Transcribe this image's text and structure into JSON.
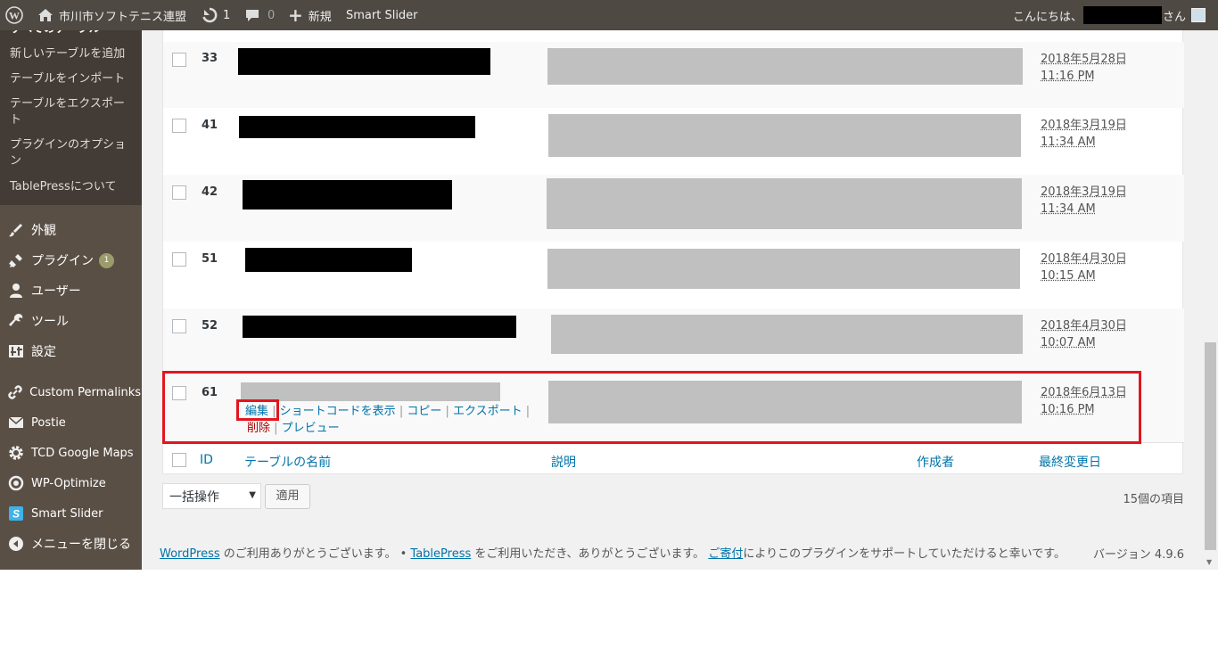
{
  "adminbar": {
    "site_name": "市川市ソフトテニス連盟",
    "updates_count": "1",
    "comments_count": "0",
    "new_label": "新規",
    "plugin_label": "Smart Slider",
    "greeting": "こんにちは、",
    "greeting_suffix": "さん"
  },
  "sidebar": {
    "partial_item": "すべてのテーブル",
    "submenu": [
      "新しいテーブルを追加",
      "テーブルをインポート",
      "テーブルをエクスポート",
      "プラグインのオプション",
      "TablePressについて"
    ],
    "menu": [
      {
        "label": "外観",
        "icon": "appearance-icon"
      },
      {
        "label": "プラグイン",
        "icon": "plugins-icon",
        "badge": "1"
      },
      {
        "label": "ユーザー",
        "icon": "users-icon"
      },
      {
        "label": "ツール",
        "icon": "tools-icon"
      },
      {
        "label": "設定",
        "icon": "settings-icon"
      },
      {
        "label": "Custom Permalinks",
        "icon": "link-icon"
      },
      {
        "label": "Postie",
        "icon": "mail-icon"
      },
      {
        "label": "TCD Google Maps",
        "icon": "gear-icon"
      },
      {
        "label": "WP-Optimize",
        "icon": "optimize-icon"
      },
      {
        "label": "Smart Slider",
        "icon": "smart-slider-icon"
      },
      {
        "label": "メニューを閉じる",
        "icon": "collapse-icon"
      }
    ]
  },
  "table": {
    "rows": [
      {
        "id": "33",
        "date": "2018年5月28日",
        "time": "11:16 PM"
      },
      {
        "id": "41",
        "date": "2018年3月19日",
        "time": "11:34 AM"
      },
      {
        "id": "42",
        "date": "2018年3月19日",
        "time": "11:34 AM"
      },
      {
        "id": "51",
        "date": "2018年4月30日",
        "time": "10:15 AM"
      },
      {
        "id": "52",
        "date": "2018年4月30日",
        "time": "10:07 AM"
      },
      {
        "id": "61",
        "date": "2018年6月13日",
        "time": "10:16 PM"
      }
    ],
    "row_actions": {
      "edit": "編集",
      "shortcode": "ショートコードを表示",
      "copy": "コピー",
      "export": "エクスポート",
      "delete": "削除",
      "preview": "プレビュー"
    },
    "headers": {
      "id": "ID",
      "name": "テーブルの名前",
      "description": "説明",
      "author": "作成者",
      "modified": "最終変更日"
    }
  },
  "bulk": {
    "selected": "一括操作",
    "apply": "適用"
  },
  "item_count": "15個の項目",
  "footer": {
    "wp_link": "WordPress",
    "text1": " のご利用ありがとうございます。 • ",
    "tp_link": "TablePress",
    "text2": " をご利用いただき、ありがとうございます。 ",
    "donate_link": "ご寄付",
    "text3": "によりこのプラグインをサポートしていただけると幸いです。",
    "version": "バージョン 4.9.6"
  },
  "colors": {
    "highlight_red": "#e3151f",
    "link_blue": "#0073aa",
    "adminbar": "#4f4943",
    "sidebar": "#5a4f45"
  }
}
